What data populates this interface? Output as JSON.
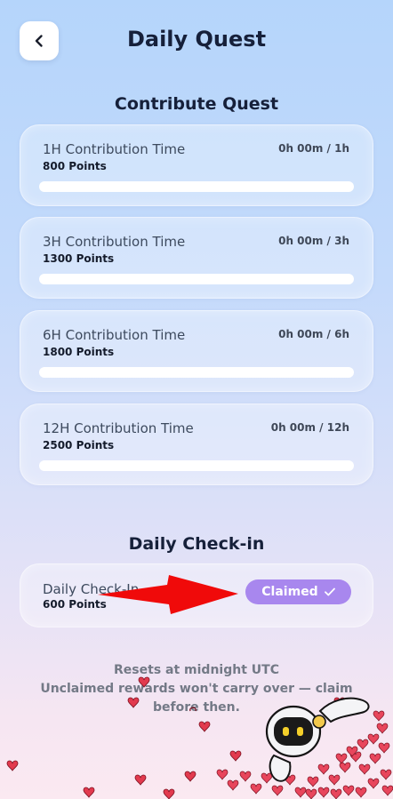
{
  "header": {
    "title": "Daily Quest",
    "back_icon": "chevron-left-icon"
  },
  "contribute": {
    "title": "Contribute Quest",
    "quests": [
      {
        "title": "1H Contribution Time",
        "points": "800 Points",
        "progress": "0h 00m / 1h",
        "fraction": 0
      },
      {
        "title": "3H Contribution Time",
        "points": "1300 Points",
        "progress": "0h 00m / 3h",
        "fraction": 0
      },
      {
        "title": "6H Contribution Time",
        "points": "1800 Points",
        "progress": "0h 00m / 6h",
        "fraction": 0
      },
      {
        "title": "12H Contribution Time",
        "points": "2500 Points",
        "progress": "0h 00m / 12h",
        "fraction": 0
      }
    ]
  },
  "checkin": {
    "title": "Daily Check-in",
    "item_title": "Daily Check-In",
    "points": "600 Points",
    "button_label": "Claimed",
    "button_icon": "check-icon",
    "button_color": "#a887ee"
  },
  "footer": {
    "line1": "Resets at midnight UTC",
    "line2": "Unclaimed rewards won't carry over — claim before then."
  },
  "colors": {
    "accent": "#a887ee",
    "arrow": "#f00a0a",
    "heart": "#e23a4e"
  }
}
